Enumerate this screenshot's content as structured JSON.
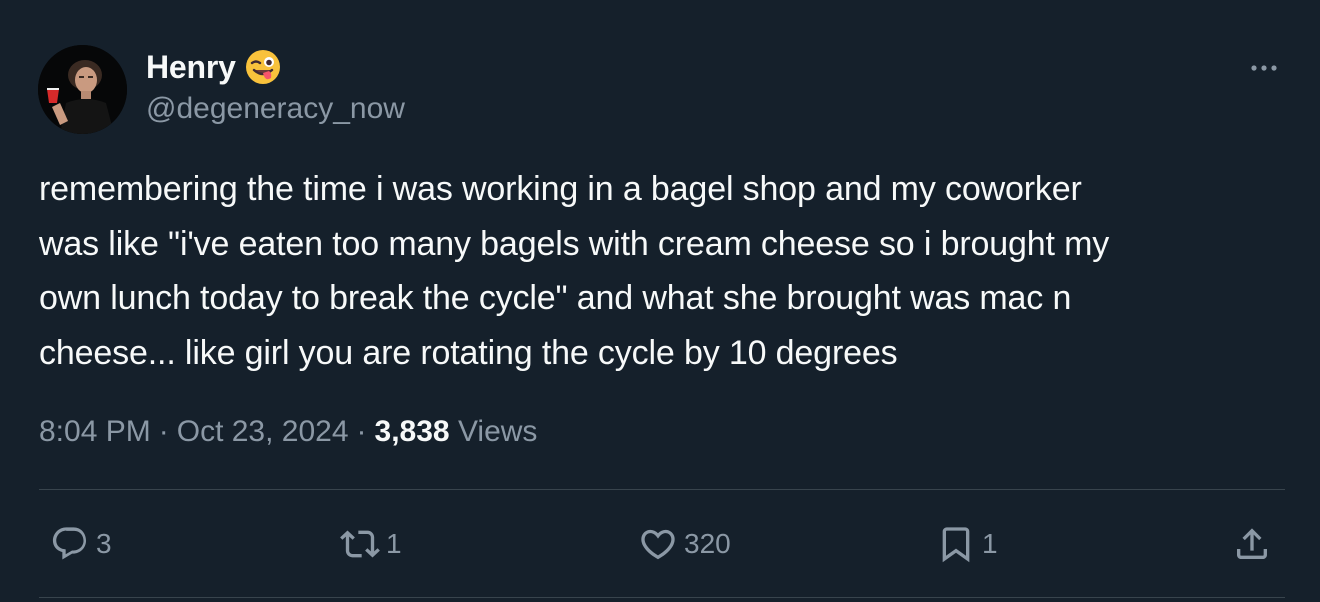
{
  "author": {
    "display_name": "Henry",
    "handle": "@degeneracy_now"
  },
  "icons": {
    "avatar": "avatar-photo",
    "name_emoji": "winking-tongue-emoji",
    "more": "more-options-icon",
    "reply": "reply-icon",
    "retweet": "retweet-icon",
    "like": "heart-icon",
    "bookmark": "bookmark-icon",
    "share": "share-icon"
  },
  "tweet": {
    "lines": [
      "remembering the time i was working in a bagel shop and my coworker",
      "was like \"i've eaten too many bagels with cream cheese so i brought my",
      "own lunch today to break the cycle\" and what she brought was mac n",
      "cheese... like girl you are rotating the cycle by 10 degrees"
    ],
    "time": "8:04 PM",
    "separator": "·",
    "date": "Oct 23, 2024",
    "views_count": "3,838",
    "views_label": "Views"
  },
  "actions": {
    "replies": "3",
    "retweets": "1",
    "likes": "320",
    "bookmarks": "1"
  },
  "colors": {
    "background": "#15202b",
    "primary_text": "#f7f9f9",
    "secondary_text": "#8b98a5",
    "divider": "#38444d",
    "emoji": "#f9c23c"
  }
}
